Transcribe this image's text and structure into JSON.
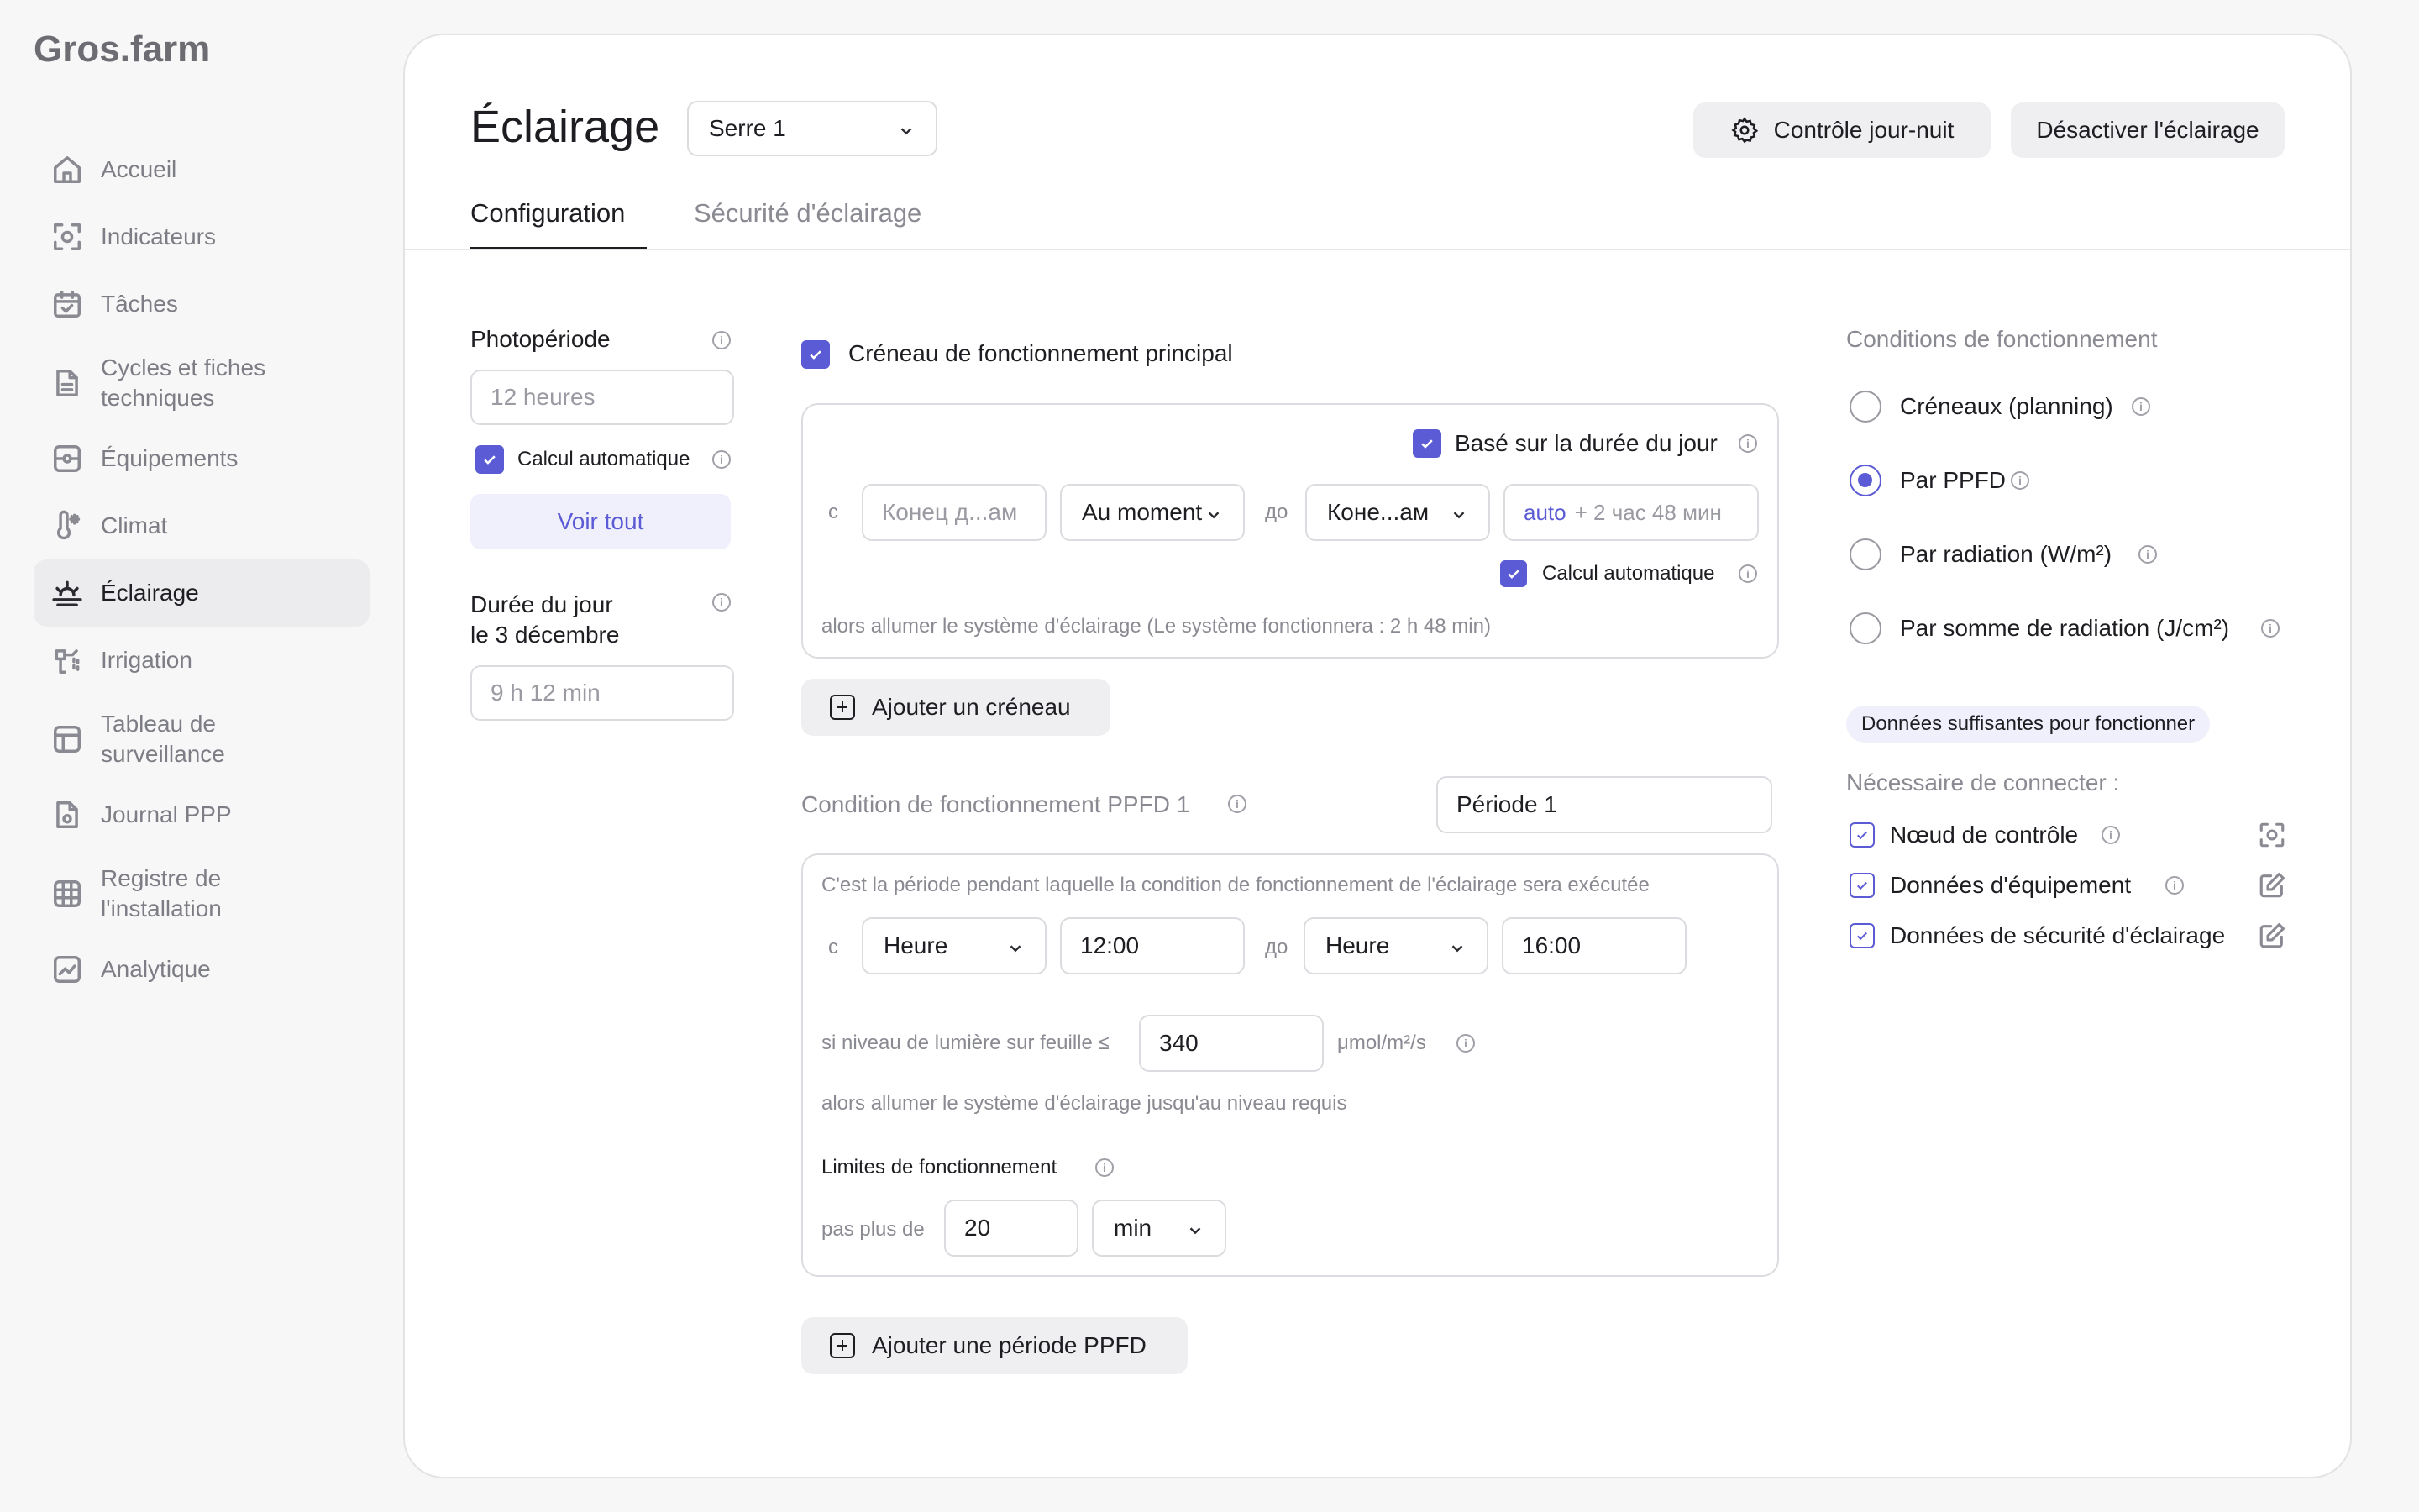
{
  "app": {
    "logo": "Gros.farm"
  },
  "sidebar": {
    "items": [
      {
        "label": "Accueil",
        "icon": "home-icon"
      },
      {
        "label": "Indicateurs",
        "icon": "indicators-icon"
      },
      {
        "label": "Tâches",
        "icon": "calendar-icon"
      },
      {
        "label": "Cycles et fiches techniques",
        "icon": "document-icon"
      },
      {
        "label": "Équipements",
        "icon": "equipment-icon"
      },
      {
        "label": "Climat",
        "icon": "thermometer-icon"
      },
      {
        "label": "Éclairage",
        "icon": "sunrise-icon",
        "active": true
      },
      {
        "label": "Irrigation",
        "icon": "irrigation-icon"
      },
      {
        "label": "Tableau de surveillance",
        "icon": "dashboard-icon"
      },
      {
        "label": "Journal PPP",
        "icon": "journal-icon"
      },
      {
        "label": "Registre de l'installation",
        "icon": "grid-icon"
      },
      {
        "label": "Analytique",
        "icon": "chart-icon"
      }
    ]
  },
  "header": {
    "title": "Éclairage",
    "greenhouse_select": "Serre 1",
    "day_night_button": "Contrôle jour-nuit",
    "disable_button": "Désactiver l'éclairage"
  },
  "tabs": [
    {
      "label": "Configuration",
      "active": true
    },
    {
      "label": "Sécurité d'éclairage",
      "active": false
    }
  ],
  "left_column": {
    "photoperiod_label": "Photopériode",
    "photoperiod_placeholder": "12 heures",
    "auto_calc_label": "Calcul automatique",
    "see_all_button": "Voir tout",
    "day_length_label_1": "Durée du jour",
    "day_length_label_2": "le 3 décembre",
    "day_length_value": "9 h 12 min"
  },
  "main_slot": {
    "checkbox_label": "Créneau de fonctionnement principal",
    "based_on_day_label": "Basé sur la durée du jour",
    "from_prefix": "с",
    "from_placeholder": "Конец д...ам",
    "moment_select": "Au moment",
    "to_prefix": "до",
    "to_select": "Коне...ам",
    "auto_value_prefix": "auto",
    "auto_value_suffix": "+ 2 час 48 мин",
    "auto_calc_label": "Calcul automatique",
    "note": "alors allumer le système d'éclairage (Le système fonctionnera : 2 h 48 min)",
    "add_slot_button": "Ajouter un créneau"
  },
  "ppfd": {
    "condition_label": "Condition de fonctionnement PPFD 1",
    "period_input": "Période 1",
    "description": "C'est la période pendant laquelle la condition de fonctionnement de l'éclairage sera exécutée",
    "from_prefix": "с",
    "from_select": "Heure",
    "from_time": "12:00",
    "to_prefix": "до",
    "to_select": "Heure",
    "to_time": "16:00",
    "light_level_label": "si niveau de lumière sur feuille ≤",
    "light_level_value": "340",
    "unit": "μmol/m²/s",
    "then_text": "alors allumer le système d'éclairage jusqu'au niveau requis",
    "limits_label": "Limites de fonctionnement",
    "no_more_than": "pas plus de",
    "limit_value": "20",
    "limit_unit": "min",
    "add_period_button": "Ajouter une période PPFD"
  },
  "conditions": {
    "title": "Conditions de fonctionnement",
    "options": [
      {
        "label": "Créneaux (planning)",
        "checked": false
      },
      {
        "label": "Par PPFD",
        "checked": true
      },
      {
        "label": "Par radiation (W/m²)",
        "checked": false
      },
      {
        "label": "Par somme de radiation (J/cm²)",
        "checked": false
      }
    ],
    "sufficient_chip": "Données suffisantes pour fonctionner",
    "required_label": "Nécessaire de connecter :",
    "required_items": [
      {
        "label": "Nœud de contrôle",
        "icon": "control-node-icon"
      },
      {
        "label": "Données d'équipement",
        "icon": "edit-icon"
      },
      {
        "label": "Données de sécurité d'éclairage",
        "icon": "edit-icon"
      }
    ]
  },
  "colors": {
    "accent": "#5b5bd6",
    "accent_light": "#f0f0fc",
    "text": "#1d1d22",
    "muted": "#8a8a92"
  }
}
